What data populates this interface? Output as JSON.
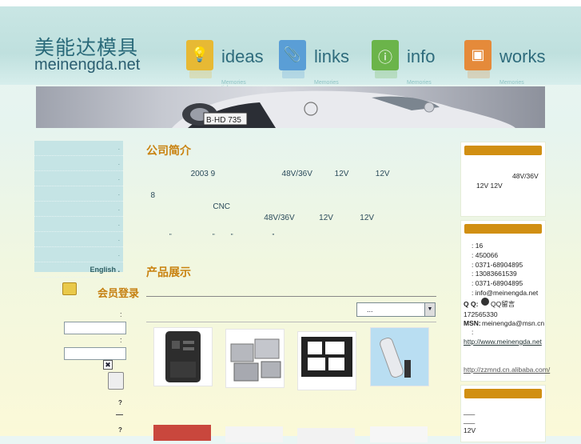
{
  "header": {
    "logo_cn": "美能达模具",
    "logo_en": "meinengda.net",
    "nav": [
      {
        "label": "ideas",
        "sub": "Memories ticb",
        "icon": "lightbulb-icon",
        "color": "#e7b934"
      },
      {
        "label": "links",
        "sub": "Memories",
        "icon": "paperclip-icon",
        "color": "#5a9ed6"
      },
      {
        "label": "info",
        "sub": "Memories",
        "icon": "info-icon",
        "color": "#6bb44a"
      },
      {
        "label": "works",
        "sub": "Memories",
        "icon": "picture-icon",
        "color": "#e58a3a"
      }
    ]
  },
  "banner": {
    "plate": "B·HD 735"
  },
  "left_sidebar": {
    "items": [
      ".",
      ".",
      ".",
      ".",
      ".",
      ".",
      ".",
      ".",
      "English ."
    ],
    "login": {
      "title": "会员登录",
      "colon1": ":",
      "colon2": ":",
      "check_mark": "✖",
      "q1": "?",
      "q2": "?"
    }
  },
  "main": {
    "about_title": "公司简介",
    "about_lines": [
      "                    2003 9                              48V/36V          12V            12V",
      "  8",
      "                              CNC",
      "                                                     48V/36V           12V            12V",
      "             \"                       \"         \"                      \""
    ],
    "products_title": "产品展示",
    "select_value": "..."
  },
  "right_sidebar": {
    "box1_lines": [
      "48V/36V",
      "12V              12V"
    ],
    "contact": {
      "l1": ":                    16",
      "l2": ":  450066",
      "l3": ":  0371-68904895",
      "l4": ": 13083661539",
      "l5": ":  0371-68904895",
      "l6": ":  info@meinengda.net",
      "qq_label": "Q Q:",
      "qq_text": "QQ留言",
      "qq_num": "172565330",
      "msn_label": "MSN:",
      "msn_value": "meinengda@msn.cn",
      "colon": ":",
      "web": "http://www.meinengda.net",
      "alibaba": "http://zzmnd.cn.alibaba.com/"
    },
    "box3_lines": [
      "___",
      "___",
      "12V"
    ]
  }
}
